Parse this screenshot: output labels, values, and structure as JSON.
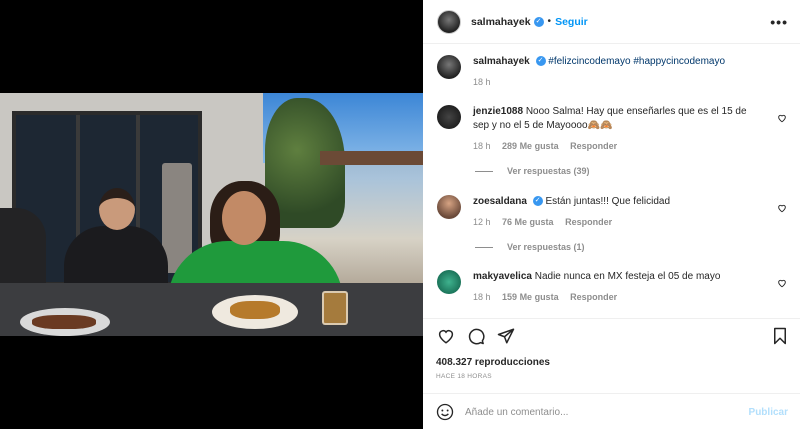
{
  "post": {
    "author": "salmahayek",
    "dot": "•",
    "follow_label": "Seguir",
    "more_label": "•••"
  },
  "caption": {
    "author": "salmahayek",
    "hashtags": "#felizcincodemayo #happycincodemayo",
    "time": "18 h"
  },
  "comments": [
    {
      "user": "jenzie1088",
      "text": "Nooo Salma! Hay que enseñarles que es el 15 de sep y no el 5 de Mayoooo🙈🙈",
      "time": "18 h",
      "likes": "289 Me gusta",
      "reply_label": "Responder",
      "replies": "Ver respuestas (39)"
    },
    {
      "user": "zoesaldana",
      "text": "Están juntas!!! Que felicidad",
      "time": "12 h",
      "likes": "76 Me gusta",
      "reply_label": "Responder",
      "replies": "Ver respuestas (1)"
    },
    {
      "user": "makyavelica",
      "text": "Nadie nunca en MX festeja el 05 de mayo",
      "time": "18 h",
      "likes": "159 Me gusta",
      "reply_label": "Responder"
    }
  ],
  "stats": {
    "views": "408.327 reproducciones",
    "ago": "HACE 18 HORAS"
  },
  "composer": {
    "placeholder": "Añade un comentario...",
    "publish_label": "Publicar"
  },
  "colors": {
    "accent": "#0095f6",
    "verified": "#3897f0",
    "muted": "#8e8e8e"
  },
  "icons": [
    "heart-icon",
    "comment-icon",
    "share-icon",
    "bookmark-icon",
    "emoji-icon",
    "mute-icon",
    "verified-icon"
  ]
}
